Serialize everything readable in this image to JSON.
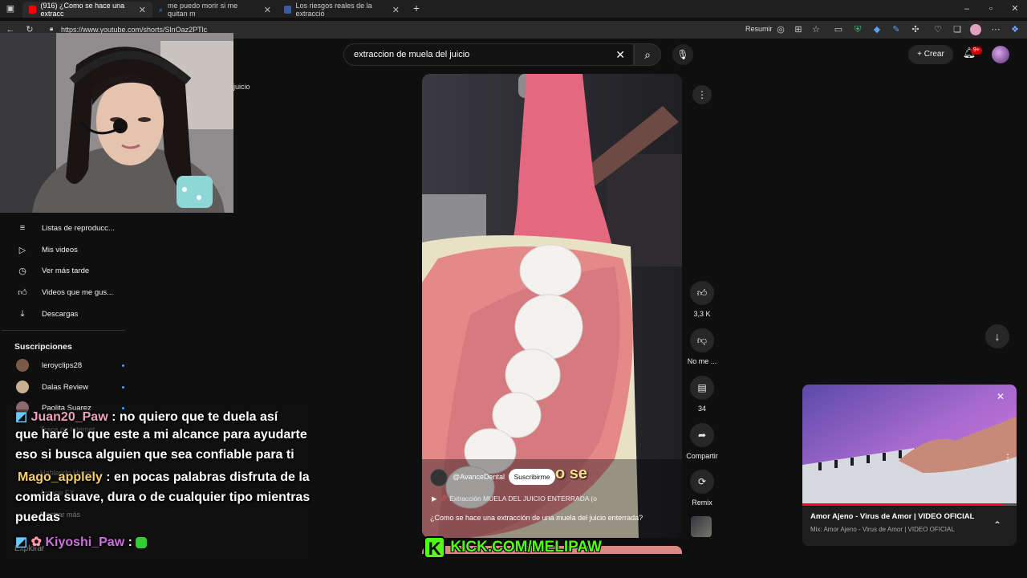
{
  "browser": {
    "tabs": [
      {
        "title": "(916) ¿Como se hace una extracc",
        "active": true
      },
      {
        "title": "me puedo morir si me quitan m",
        "active": false
      },
      {
        "title": "Los riesgos reales de la extracció",
        "active": false
      }
    ],
    "url": "https://www.youtube.com/shorts/SlnOaz2PTlc",
    "summarize_label": "Resumir"
  },
  "youtube": {
    "search_value": "extraccion de muela del juicio",
    "create_label": "Crear",
    "notif_count": "9+",
    "history_fragment": "juicio"
  },
  "sidebar": {
    "you_items": [
      {
        "icon": "playlist-icon",
        "label": "Listas de reproducc..."
      },
      {
        "icon": "my-videos-icon",
        "label": "Mis videos"
      },
      {
        "icon": "watch-later-icon",
        "label": "Ver más tarde"
      },
      {
        "icon": "liked-icon",
        "label": "Videos que me gus..."
      },
      {
        "icon": "download-icon",
        "label": "Descargas"
      }
    ],
    "subscriptions_title": "Suscripciones",
    "subscriptions": [
      {
        "label": "leroyclips28",
        "color": "#7a5a48"
      },
      {
        "label": "Dalas Review",
        "color": "#c8b090"
      },
      {
        "label": "Paolita Suarez",
        "color": "#8a6a6a"
      }
    ],
    "faded_items": [
      "Trace on Internet",
      "Hablando Huevo",
      "Arcane FX",
      "Mostrar más"
    ],
    "explore_label": "Explorar"
  },
  "short": {
    "channel": "@AvanceDental",
    "subscribe_label": "Suscribirme",
    "caption_overlay": "o se",
    "playlist_line": "Extracción MUELA DEL JUICIO ENTERRADA (o",
    "title": "¿Como se hace una extracción de una muela del juicio enterrada?",
    "likes": "3,3 K",
    "dislike_label": "No me ...",
    "comments": "34",
    "share_label": "Compartir",
    "remix_label": "Remix"
  },
  "chat": [
    {
      "user": "Juan20_Paw",
      "user_color": "#f0a0c0",
      "text": ": no quiero que te duela así"
    },
    {
      "user": "",
      "user_color": "#ffffff",
      "text": "que haré lo que este a mi alcance para ayudarte"
    },
    {
      "user": "",
      "user_color": "#ffffff",
      "text": "eso si busca alguien que sea confiable para ti"
    },
    {
      "user": "Mago_applely",
      "user_color": "#f5d06a",
      "text": ": en pocas palabras disfruta de la"
    },
    {
      "user": "",
      "user_color": "#ffffff",
      "text": "comida suave, dura o de cualquier tipo mientras"
    },
    {
      "user": "",
      "user_color": "#ffffff",
      "text": "puedas"
    },
    {
      "user": "Kiyoshi_Paw",
      "user_color": "#d070e0",
      "text": ":"
    }
  ],
  "kick_label": "KICK.COM/MELIPAW",
  "miniplayer": {
    "title": "Amor Ajeno - Virus de Amor | VIDEO OFICIAL",
    "subtitle": "Mix: Amor Ajeno - Virus de Amor | VIDEO OFICIAL",
    "progress": 0.94
  },
  "colors": {
    "accent": "#ff0033",
    "kick_green": "#53fc18"
  }
}
